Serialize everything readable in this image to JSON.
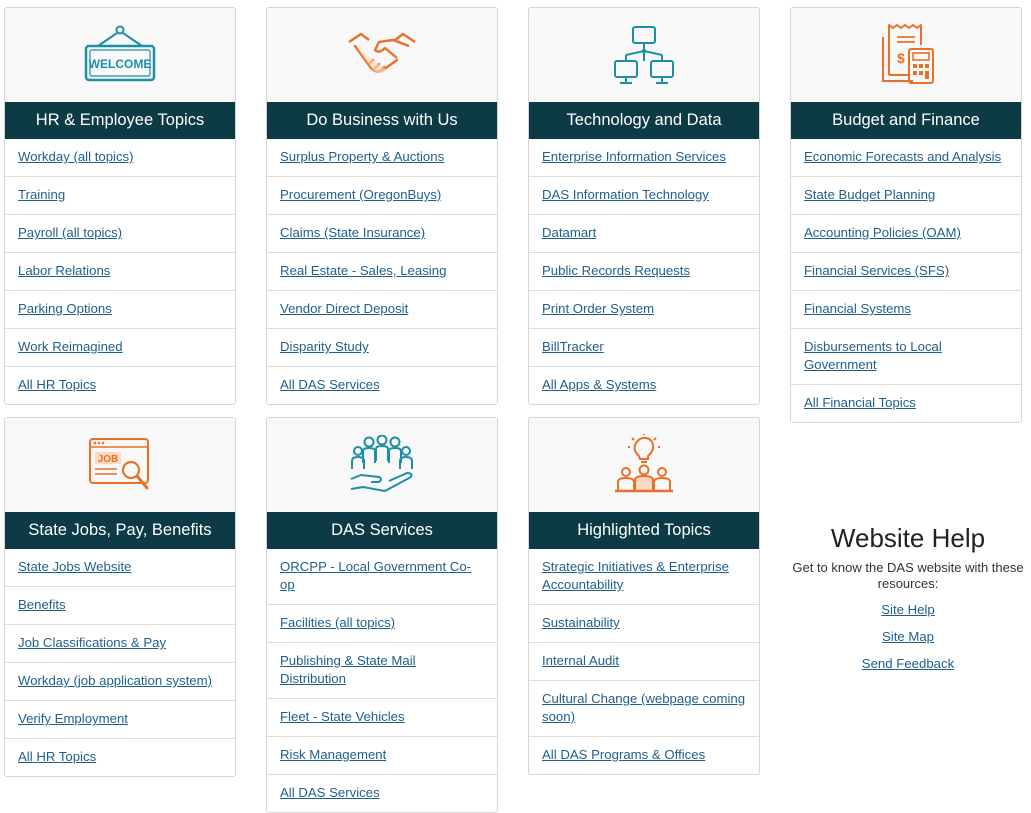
{
  "colors": {
    "header_bg": "#0c3a45",
    "link": "#1f5f8b",
    "icon_orange": "#e8712a",
    "icon_teal": "#1b8fa6"
  },
  "cards": [
    {
      "title": "HR & Employee Topics",
      "icon": "welcome-sign-icon",
      "icon_text": "WELCOME",
      "links": [
        "Workday (all topics)",
        "Training",
        "Payroll (all topics)",
        "Labor Relations",
        "Parking Options",
        "Work Reimagined",
        "All HR Topics"
      ]
    },
    {
      "title": "Do Business with Us",
      "icon": "handshake-icon",
      "links": [
        "Surplus Property & Auctions",
        "Procurement (OregonBuys)",
        "Claims (State Insurance)",
        "Real Estate - Sales, Leasing",
        "Vendor Direct Deposit",
        "Disparity Study",
        "All DAS Services"
      ]
    },
    {
      "title": "Technology and Data",
      "icon": "network-icon",
      "links": [
        "Enterprise Information Services",
        "DAS Information Technology",
        "Datamart",
        "Public Records Requests",
        "Print Order System",
        "BillTracker",
        "All Apps & Systems"
      ]
    },
    {
      "title": "Budget and Finance",
      "icon": "budget-calculator-icon",
      "links": [
        "Economic Forecasts and Analysis",
        "State Budget Planning",
        "Accounting Policies (OAM)",
        "Financial Services (SFS)",
        "Financial Systems",
        "Disbursements to Local Government",
        "All Financial Topics"
      ]
    },
    {
      "title": "State Jobs, Pay, Benefits",
      "icon": "job-search-icon",
      "icon_text": "JOB",
      "links": [
        "State Jobs Website",
        "Benefits",
        "Job Classifications & Pay",
        "Workday (job application system)",
        "Verify Employment",
        "All HR Topics"
      ]
    },
    {
      "title": "DAS Services",
      "icon": "people-hand-icon",
      "links": [
        "ORCPP - Local Government Co-op",
        "Facilities (all topics)",
        "Publishing & State Mail Distribution",
        "Fleet - State Vehicles",
        "Risk Management",
        "All DAS Services"
      ]
    },
    {
      "title": "Highlighted Topics",
      "icon": "idea-team-icon",
      "links": [
        "Strategic Initiatives & Enterprise Accountability",
        "Sustainability",
        "Internal Audit",
        "Cultural Change (webpage coming soon)",
        "All DAS Programs & Offices"
      ]
    }
  ],
  "help": {
    "title": "Website Help",
    "description": "Get to know the DAS website with these resources:",
    "links": [
      "Site Help",
      "Site Map",
      "Send Feedback"
    ]
  }
}
